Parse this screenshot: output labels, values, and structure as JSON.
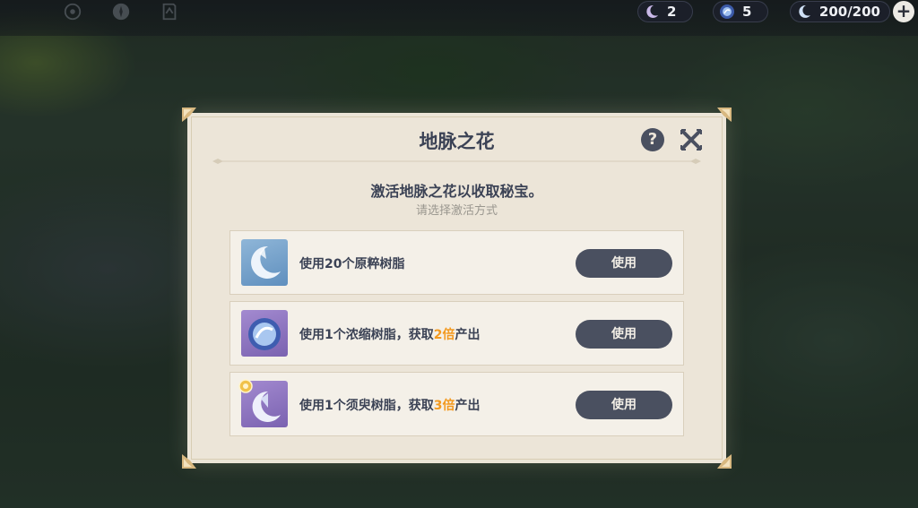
{
  "hud": {
    "icons": [
      "eye-icon",
      "compass-icon",
      "book-icon"
    ],
    "currencies": [
      {
        "name": "fragile-resin-icon",
        "value": "2"
      },
      {
        "name": "condensed-resin-icon",
        "value": "5"
      },
      {
        "name": "original-resin-icon",
        "value": "200/200"
      }
    ],
    "plus_label": "+"
  },
  "dialog": {
    "title": "地脉之花",
    "help_label": "?",
    "subtitle": "激活地脉之花以收取秘宝。",
    "hint": "请选择激活方式",
    "options": [
      {
        "icon": "original-resin-icon",
        "text_prefix": "使用20个原粹树脂",
        "highlight": "",
        "text_suffix": "",
        "button": "使用"
      },
      {
        "icon": "condensed-resin-icon",
        "text_prefix": "使用1个浓缩树脂，获取",
        "highlight": "2倍",
        "text_suffix": "产出",
        "button": "使用"
      },
      {
        "icon": "transient-resin-icon",
        "text_prefix": "使用1个须臾树脂，获取",
        "highlight": "3倍",
        "text_suffix": "产出",
        "button": "使用"
      }
    ]
  },
  "colors": {
    "panel": "#ece5d8",
    "button": "#4a5060",
    "highlight": "#f39a21",
    "text": "#3b4255"
  }
}
